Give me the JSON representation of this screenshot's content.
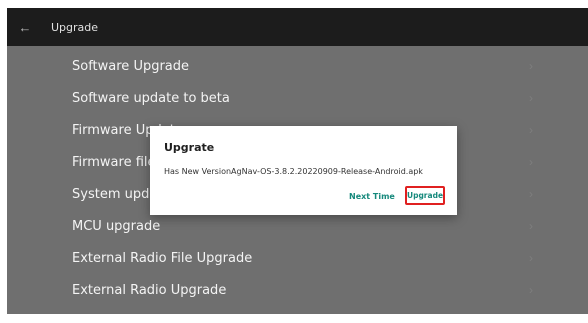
{
  "appbar": {
    "title": "Upgrade",
    "back_icon": "arrow-left-icon"
  },
  "settings": {
    "items": [
      {
        "label": "Software Upgrade"
      },
      {
        "label": "Software update to beta"
      },
      {
        "label": "Firmware Update"
      },
      {
        "label": "Firmware file"
      },
      {
        "label": "System update"
      },
      {
        "label": "MCU upgrade"
      },
      {
        "label": "External Radio File Upgrade"
      },
      {
        "label": "External Radio Upgrade"
      }
    ],
    "chevron_icon": "chevron-right-icon"
  },
  "dialog": {
    "title": "Upgrate",
    "message": "Has New VersionAgNav-OS-3.8.2.20220909-Release-Android.apk",
    "next_label": "Next Time",
    "upgrade_label": "Upgrade",
    "highlight_color": "#e02020",
    "accent_color": "#16897c"
  }
}
